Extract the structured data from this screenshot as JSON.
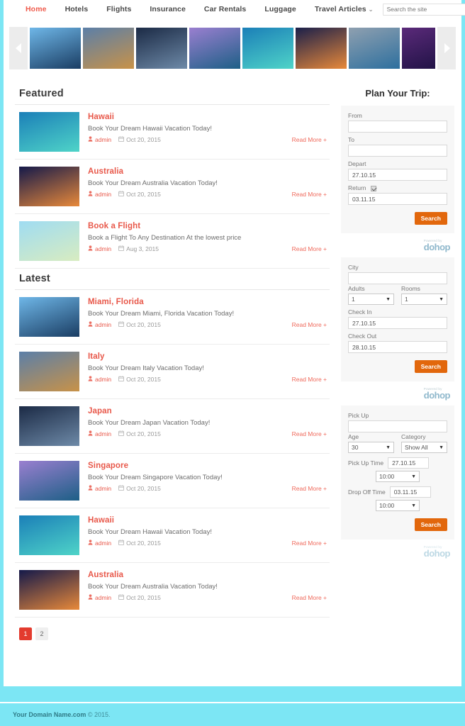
{
  "header": {
    "nav": [
      {
        "label": "Home",
        "active": true,
        "caret": false
      },
      {
        "label": "Hotels",
        "active": false,
        "caret": false
      },
      {
        "label": "Flights",
        "active": false,
        "caret": false
      },
      {
        "label": "Insurance",
        "active": false,
        "caret": false
      },
      {
        "label": "Car Rentals",
        "active": false,
        "caret": false
      },
      {
        "label": "Luggage",
        "active": false,
        "caret": false
      },
      {
        "label": "Travel Articles",
        "active": false,
        "caret": true
      }
    ],
    "search_placeholder": "Search the site",
    "search_value": ""
  },
  "carousel": {
    "prev_label": "Previous",
    "next_label": "Next",
    "slides": [
      {
        "name": "miami-florida",
        "c1": "#6fb7e8",
        "c2": "#1a3d63"
      },
      {
        "name": "italy-colosseum",
        "c1": "#5b7fa8",
        "c2": "#c89248"
      },
      {
        "name": "japan-mount-fuji",
        "c1": "#1b2a45",
        "c2": "#6e8aa8"
      },
      {
        "name": "singapore-marina",
        "c1": "#9a7fd0",
        "c2": "#1d5f86"
      },
      {
        "name": "hawaii-beach",
        "c1": "#1b7fb8",
        "c2": "#4fd4c8"
      },
      {
        "name": "australia-sign",
        "c1": "#1a1f4a",
        "c2": "#e8893a"
      },
      {
        "name": "city-aerial",
        "c1": "#8fa0b0",
        "c2": "#2d6f9e"
      },
      {
        "name": "night-ferris-wheel",
        "c1": "#5b2a7a",
        "c2": "#1a1040"
      }
    ]
  },
  "featured": {
    "title": "Featured",
    "posts": [
      {
        "title": "Hawaii",
        "excerpt": "Book Your Dream Hawaii Vacation Today!",
        "author": "admin",
        "date": "Oct 20, 2015",
        "read_more": "Read More +",
        "thumb": "hawaii-beach",
        "c1": "#1b7fb8",
        "c2": "#4fd4c8"
      },
      {
        "title": "Australia",
        "excerpt": "Book Your Dream Australia Vacation Today!",
        "author": "admin",
        "date": "Oct 20, 2015",
        "read_more": "Read More +",
        "thumb": "australia-sign",
        "c1": "#14194a",
        "c2": "#e8893a"
      },
      {
        "title": "Book a Flight",
        "excerpt": "Book a Flight To Any Destination At the lowest price",
        "author": "admin",
        "date": "Aug 3, 2015",
        "read_more": "Read More +",
        "thumb": "flight-online-booking",
        "c1": "#9fdcf2",
        "c2": "#d8ecc0"
      }
    ]
  },
  "latest": {
    "title": "Latest",
    "posts": [
      {
        "title": "Miami, Florida",
        "excerpt": "Book Your Dream Miami, Florida Vacation Today!",
        "author": "admin",
        "date": "Oct 20, 2015",
        "read_more": "Read More +",
        "thumb": "miami-florida",
        "c1": "#6fb7e8",
        "c2": "#1a3d63"
      },
      {
        "title": "Italy",
        "excerpt": "Book Your Dream Italy Vacation Today!",
        "author": "admin",
        "date": "Oct 20, 2015",
        "read_more": "Read More +",
        "thumb": "italy-colosseum",
        "c1": "#5b7fa8",
        "c2": "#c89248"
      },
      {
        "title": "Japan",
        "excerpt": "Book Your Dream Japan Vacation Today!",
        "author": "admin",
        "date": "Oct 20, 2015",
        "read_more": "Read More +",
        "thumb": "japan-mount-fuji",
        "c1": "#1b2a45",
        "c2": "#6e8aa8"
      },
      {
        "title": "Singapore",
        "excerpt": "Book Your Dream Singapore Vacation Today!",
        "author": "admin",
        "date": "Oct 20, 2015",
        "read_more": "Read More +",
        "thumb": "singapore-marina",
        "c1": "#9a7fd0",
        "c2": "#1d5f86"
      },
      {
        "title": "Hawaii",
        "excerpt": "Book Your Dream Hawaii Vacation Today!",
        "author": "admin",
        "date": "Oct 20, 2015",
        "read_more": "Read More +",
        "thumb": "hawaii-beach",
        "c1": "#1b7fb8",
        "c2": "#4fd4c8"
      },
      {
        "title": "Australia",
        "excerpt": "Book Your Dream Australia Vacation Today!",
        "author": "admin",
        "date": "Oct 20, 2015",
        "read_more": "Read More +",
        "thumb": "australia-sign",
        "c1": "#14194a",
        "c2": "#e8893a"
      }
    ]
  },
  "pagination": {
    "pages": [
      {
        "label": "1",
        "active": true
      },
      {
        "label": "2",
        "active": false
      }
    ]
  },
  "sidebar": {
    "title": "Plan Your Trip:",
    "flight_widget": {
      "from_label": "From",
      "from_value": "",
      "to_label": "To",
      "to_value": "",
      "depart_label": "Depart",
      "depart_value": "27.10.15",
      "return_label": "Return",
      "return_checked": true,
      "return_value": "03.11.15",
      "search_label": "Search",
      "brand_powered": "Powered by",
      "brand_name": "dohop"
    },
    "hotel_widget": {
      "city_label": "City",
      "city_value": "",
      "adults_label": "Adults",
      "adults_value": "1",
      "rooms_label": "Rooms",
      "rooms_value": "1",
      "checkin_label": "Check In",
      "checkin_value": "27.10.15",
      "checkout_label": "Check Out",
      "checkout_value": "28.10.15",
      "search_label": "Search",
      "brand_powered": "Powered by",
      "brand_name": "dohop"
    },
    "car_widget": {
      "pickup_label": "Pick Up",
      "pickup_value": "",
      "age_label": "Age",
      "age_value": "30",
      "category_label": "Category",
      "category_value": "Show All",
      "pickup_time_label": "Pick Up Time",
      "pickup_date_value": "27.10.15",
      "pickup_hour_value": "10:00",
      "dropoff_time_label": "Drop Off Time",
      "dropoff_date_value": "03.11.15",
      "dropoff_hour_value": "10:00",
      "search_label": "Search",
      "brand_powered": "Powered by",
      "brand_name": "dohop"
    }
  },
  "footer": {
    "domain": "Your Domain Name.com",
    "copyright": "© 2015."
  }
}
